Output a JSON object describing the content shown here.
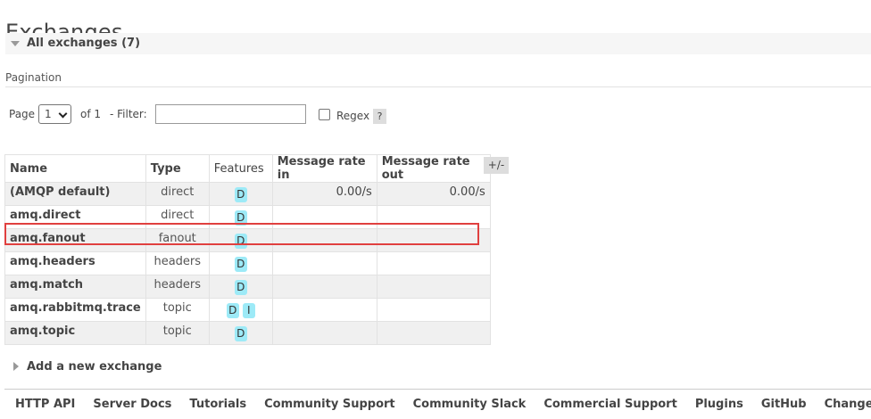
{
  "page": {
    "title": "Exchanges"
  },
  "section": {
    "label": "All exchanges (7)"
  },
  "pagination": {
    "heading": "Pagination",
    "page_label": "Page",
    "page_value": "1",
    "of_label": "of 1",
    "filter_label": "- Filter:",
    "filter_value": "",
    "regex_label": "Regex",
    "help_label": "?"
  },
  "table": {
    "headers": {
      "name": "Name",
      "type": "Type",
      "features": "Features",
      "rate_in": "Message rate in",
      "rate_out": "Message rate out"
    },
    "toggle_label": "+/-",
    "rows": [
      {
        "name": "(AMQP default)",
        "type": "direct",
        "features": [
          "D"
        ],
        "rate_in": "0.00/s",
        "rate_out": "0.00/s"
      },
      {
        "name": "amq.direct",
        "type": "direct",
        "features": [
          "D"
        ],
        "rate_in": "",
        "rate_out": ""
      },
      {
        "name": "amq.fanout",
        "type": "fanout",
        "features": [
          "D"
        ],
        "rate_in": "",
        "rate_out": ""
      },
      {
        "name": "amq.headers",
        "type": "headers",
        "features": [
          "D"
        ],
        "rate_in": "",
        "rate_out": ""
      },
      {
        "name": "amq.match",
        "type": "headers",
        "features": [
          "D"
        ],
        "rate_in": "",
        "rate_out": ""
      },
      {
        "name": "amq.rabbitmq.trace",
        "type": "topic",
        "features": [
          "D",
          "I"
        ],
        "rate_in": "",
        "rate_out": ""
      },
      {
        "name": "amq.topic",
        "type": "topic",
        "features": [
          "D"
        ],
        "rate_in": "",
        "rate_out": ""
      }
    ]
  },
  "add_section": {
    "label": "Add a new exchange"
  },
  "footer": {
    "links": [
      "HTTP API",
      "Server Docs",
      "Tutorials",
      "Community Support",
      "Community Slack",
      "Commercial Support",
      "Plugins",
      "GitHub",
      "Changelog"
    ]
  },
  "colors": {
    "highlight": "#e0403f",
    "badge": "#9deaf7",
    "row_alt": "#f0f0f0"
  }
}
